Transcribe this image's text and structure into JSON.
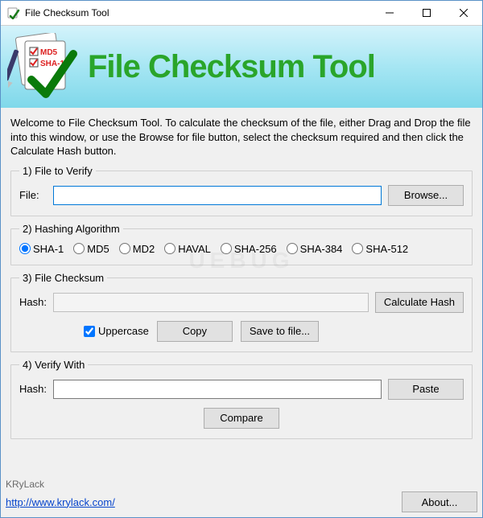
{
  "window": {
    "title": "File Checksum Tool"
  },
  "banner": {
    "logo": {
      "tag1": "MD5",
      "tag2": "SHA-1"
    },
    "title": "File Checksum Tool"
  },
  "intro": "Welcome to File Checksum Tool. To calculate the checksum of the file, either Drag and Drop the file into this window, or use the Browse for file button, select the checksum required and then click the Calculate Hash button.",
  "group1": {
    "legend": "1) File to Verify",
    "file_label": "File:",
    "file_value": "",
    "browse": "Browse..."
  },
  "group2": {
    "legend": "2) Hashing Algorithm",
    "selected": "SHA-1",
    "options": [
      "SHA-1",
      "MD5",
      "MD2",
      "HAVAL",
      "SHA-256",
      "SHA-384",
      "SHA-512"
    ]
  },
  "group3": {
    "legend": "3) File Checksum",
    "hash_label": "Hash:",
    "hash_value": "",
    "calculate": "Calculate Hash",
    "uppercase_label": "Uppercase",
    "uppercase_checked": true,
    "copy": "Copy",
    "save": "Save to file..."
  },
  "group4": {
    "legend": "4) Verify With",
    "hash_label": "Hash:",
    "hash_value": "",
    "paste": "Paste",
    "compare": "Compare"
  },
  "footer": {
    "brand": "KRyLack",
    "url_text": "http://www.krylack.com/",
    "about": "About..."
  },
  "watermark": "UEBUG"
}
